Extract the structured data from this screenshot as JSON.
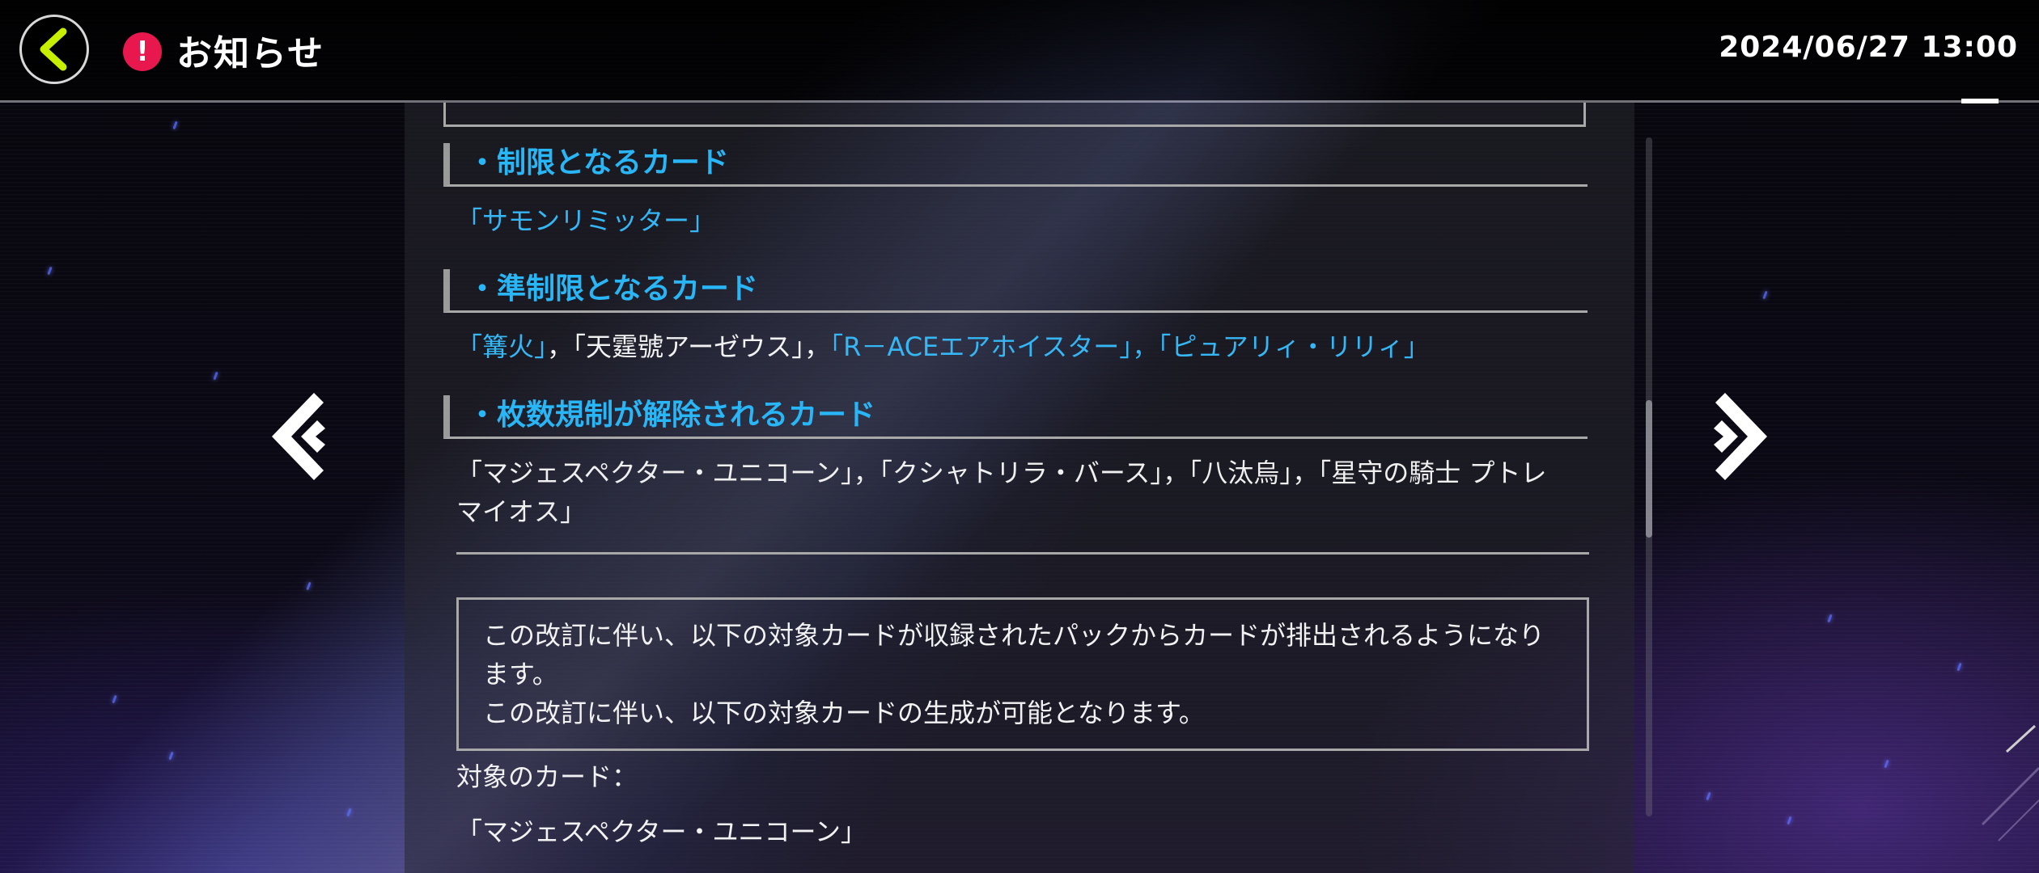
{
  "header": {
    "title": "お知らせ",
    "alert_symbol": "!",
    "datetime": "2024/06/27 13:00"
  },
  "sections": [
    {
      "heading": "・制限となるカード",
      "cards": [
        {
          "text": "「サモンリミッター」",
          "color": "blue"
        }
      ]
    },
    {
      "heading": "・準制限となるカード",
      "cards": [
        {
          "text": "「篝火」",
          "color": "blue"
        },
        {
          "text": "，",
          "color": "white"
        },
        {
          "text": "「天霆號アーゼウス」",
          "color": "white"
        },
        {
          "text": "，",
          "color": "white"
        },
        {
          "text": "「R－ACEエアホイスター」",
          "color": "blue"
        },
        {
          "text": "，",
          "color": "blue"
        },
        {
          "text": "「ピュアリィ・リリィ」",
          "color": "blue"
        }
      ]
    },
    {
      "heading": "・枚数規制が解除されるカード",
      "cards_line1": "「マジェスペクター・ユニコーン」，「クシャトリラ・バース」，「八汰烏」，「星守の騎士 プトレ",
      "cards_line2": "マイオス」"
    }
  ],
  "notice": {
    "line1": "この改訂に伴い、以下の対象カードが収録されたパックからカードが排出されるようになり",
    "line2": "ます。",
    "line3": "この改訂に伴い、以下の対象カードの生成が可能となります。"
  },
  "target_label": "対象のカード：",
  "target_card": "「マジェスペクター・ユニコーン」",
  "colors": {
    "accent_blue": "#29b6f6",
    "alert_red": "#e8174e",
    "back_arrow": "#c6f000"
  },
  "icons": {
    "back": "chevron-left-icon",
    "alert": "exclamation-icon",
    "prev": "double-chevron-left-icon",
    "next": "double-chevron-right-icon"
  }
}
